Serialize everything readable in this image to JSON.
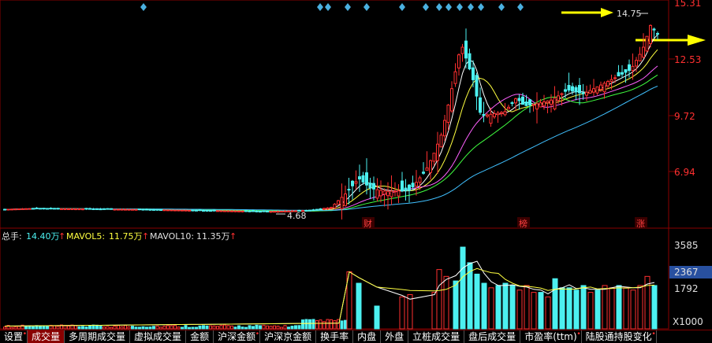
{
  "price_axis": {
    "ticks": [
      "15.31",
      "12.53",
      "9.72",
      "6.94"
    ]
  },
  "annotations": {
    "high_label": "14.75",
    "low_label": "4.68",
    "event_markers": [
      "财",
      "榜",
      "涨"
    ]
  },
  "volume_header": {
    "total_label": "总手:",
    "total_value": "14.40万",
    "mavol5_label": "MAVOL5:",
    "mavol5_value": "11.75万",
    "mavol10_label": "MAVOL10:",
    "mavol10_value": "11.35万",
    "arrow": "↑"
  },
  "volume_axis": {
    "ticks": [
      "3585",
      "1792"
    ],
    "highlight": "2367",
    "unit": "X1000"
  },
  "tabs": [
    {
      "label": "设置",
      "dot": true
    },
    {
      "label": "成交量",
      "active": true
    },
    {
      "label": "多周期成交量"
    },
    {
      "label": "虚拟成交量"
    },
    {
      "label": "金额"
    },
    {
      "label": "沪深金额",
      "dot": true
    },
    {
      "label": "沪深京金额"
    },
    {
      "label": "换手率"
    },
    {
      "label": "内盘"
    },
    {
      "label": "外盘"
    },
    {
      "label": "立桩成交量"
    },
    {
      "label": "盘后成交量"
    },
    {
      "label": "市盈率(ttm)",
      "dot": true
    },
    {
      "label": "陆股通持股变化",
      "dot": true
    }
  ],
  "colors": {
    "up": "#ff3030",
    "down": "#4cf0f0",
    "ma5": "#ffffff",
    "ma10": "#ffff40",
    "ma20": "#ff60ff",
    "ma30": "#40ff40",
    "ma60": "#40c0ff",
    "diamond": "#4ab0e0",
    "arrow": "#ffff00"
  },
  "chart_data": [
    {
      "type": "candlestick",
      "y_axis_ticks": [
        15.31,
        12.53,
        9.72,
        6.94
      ],
      "high_marker": 14.75,
      "low_marker": 4.68,
      "price_points": [
        [
          0,
          5.05
        ],
        [
          40,
          5.1
        ],
        [
          100,
          5.08
        ],
        [
          180,
          5.05
        ],
        [
          260,
          5.0
        ],
        [
          340,
          4.95
        ],
        [
          390,
          5.0
        ],
        [
          420,
          5.15
        ],
        [
          440,
          5.9
        ],
        [
          455,
          6.6
        ],
        [
          470,
          6.1
        ],
        [
          490,
          5.95
        ],
        [
          520,
          6.0
        ],
        [
          540,
          7.0
        ],
        [
          550,
          7.8
        ],
        [
          560,
          8.8
        ],
        [
          570,
          10.5
        ],
        [
          585,
          13.3
        ],
        [
          600,
          11.5
        ],
        [
          610,
          9.7
        ],
        [
          625,
          9.8
        ],
        [
          640,
          9.9
        ],
        [
          655,
          10.6
        ],
        [
          665,
          10.2
        ],
        [
          680,
          10.3
        ],
        [
          700,
          10.5
        ],
        [
          720,
          11.0
        ],
        [
          740,
          10.8
        ],
        [
          760,
          11.2
        ],
        [
          780,
          11.6
        ],
        [
          800,
          12.0
        ],
        [
          815,
          13.0
        ],
        [
          825,
          14.2
        ],
        [
          833,
          13.8
        ]
      ]
    },
    {
      "type": "bar",
      "title": "成交量",
      "unit": "X1000",
      "y_axis_ticks": [
        3585,
        1792
      ],
      "current": 2367,
      "bars": [
        [
          443,
          2500,
          "up"
        ],
        [
          455,
          2000,
          "down"
        ],
        [
          478,
          1000,
          "down"
        ],
        [
          510,
          1400,
          "up"
        ],
        [
          520,
          1500,
          "up"
        ],
        [
          551,
          1600,
          "up"
        ],
        [
          557,
          2600,
          "up"
        ],
        [
          566,
          2300,
          "up"
        ],
        [
          578,
          2100,
          "down"
        ],
        [
          587,
          3585,
          "down"
        ],
        [
          596,
          2900,
          "down"
        ],
        [
          605,
          2400,
          "down"
        ],
        [
          614,
          2000,
          "down"
        ],
        [
          623,
          1800,
          "up"
        ],
        [
          632,
          1900,
          "down"
        ],
        [
          641,
          2000,
          "down"
        ],
        [
          650,
          1900,
          "down"
        ],
        [
          659,
          1700,
          "up"
        ],
        [
          668,
          1900,
          "up"
        ],
        [
          677,
          1600,
          "up"
        ],
        [
          686,
          1600,
          "down"
        ],
        [
          695,
          1400,
          "up"
        ],
        [
          704,
          2200,
          "down"
        ],
        [
          713,
          1800,
          "down"
        ],
        [
          722,
          1800,
          "down"
        ],
        [
          731,
          1700,
          "down"
        ],
        [
          740,
          1900,
          "down"
        ],
        [
          749,
          1600,
          "up"
        ],
        [
          758,
          1700,
          "down"
        ],
        [
          767,
          1900,
          "up"
        ],
        [
          776,
          1800,
          "up"
        ],
        [
          785,
          1900,
          "down"
        ],
        [
          794,
          1800,
          "up"
        ],
        [
          803,
          1700,
          "up"
        ],
        [
          812,
          1900,
          "up"
        ],
        [
          821,
          2300,
          "up"
        ],
        [
          830,
          1900,
          "down"
        ]
      ]
    }
  ]
}
